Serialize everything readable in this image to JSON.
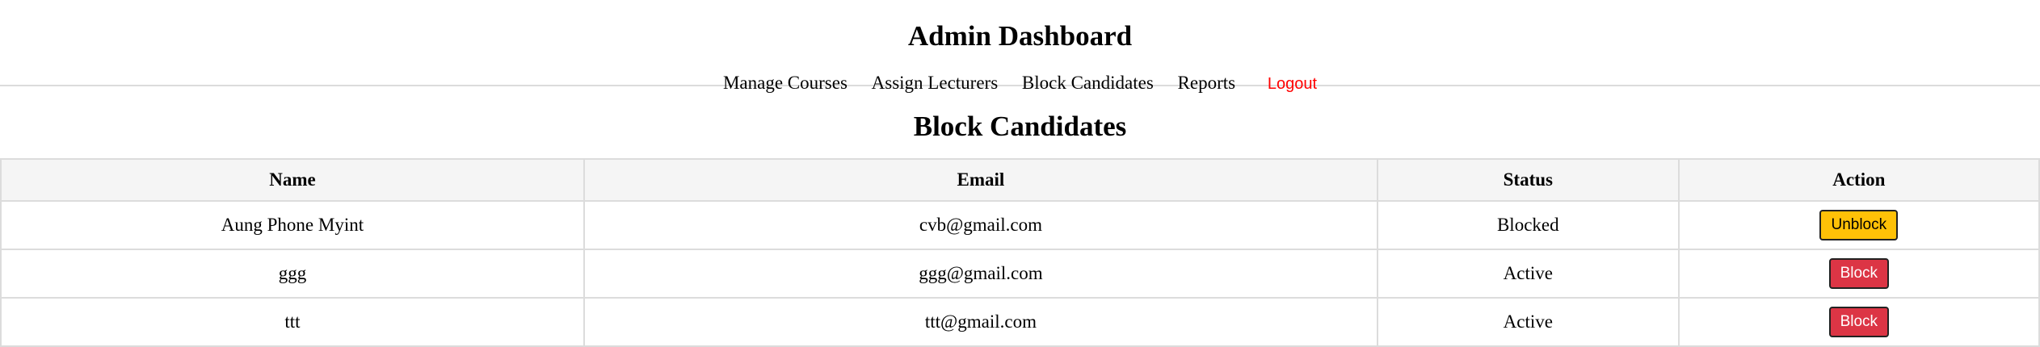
{
  "header": {
    "title": "Admin Dashboard",
    "nav": [
      {
        "label": "Manage Courses"
      },
      {
        "label": "Assign Lecturers"
      },
      {
        "label": "Block Candidates"
      },
      {
        "label": "Reports"
      }
    ],
    "logout_label": "Logout"
  },
  "page": {
    "title": "Block Candidates"
  },
  "table": {
    "columns": [
      "Name",
      "Email",
      "Status",
      "Action"
    ],
    "rows": [
      {
        "name": "Aung Phone Myint",
        "email": "cvb@gmail.com",
        "status": "Blocked",
        "action": "Unblock"
      },
      {
        "name": "ggg",
        "email": "ggg@gmail.com",
        "status": "Active",
        "action": "Block"
      },
      {
        "name": "ttt",
        "email": "ttt@gmail.com",
        "status": "Active",
        "action": "Block"
      }
    ]
  },
  "colors": {
    "logout": "#ff0000",
    "unblock_button": "#ffc107",
    "block_button": "#dc3545",
    "table_header_bg": "#f5f5f5",
    "border": "#dcdcdc"
  }
}
